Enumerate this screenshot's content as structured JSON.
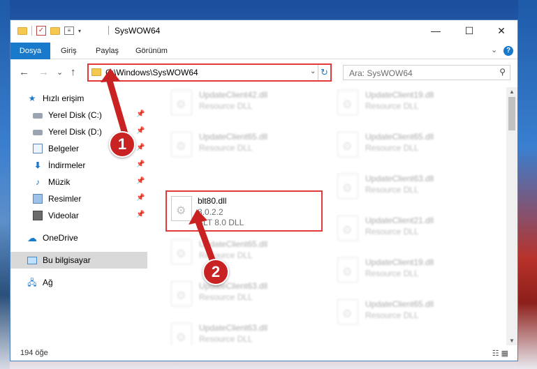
{
  "window": {
    "title": "SysWOW64",
    "controls": {
      "minimize": "—",
      "maximize": "☐",
      "close": "✕"
    }
  },
  "ribbon": {
    "tabs": [
      "Dosya",
      "Giriş",
      "Paylaş",
      "Görünüm"
    ],
    "help": "?"
  },
  "navigation": {
    "back": "←",
    "forward": "→",
    "recent": "⌄",
    "up": "↑",
    "address": "C:\\Windows\\SysWOW64",
    "search_placeholder": "Ara: SysWOW64"
  },
  "sidebar": {
    "items": [
      {
        "label": "Hızlı erişim",
        "icon": "star-icon",
        "pinned": false
      },
      {
        "label": "Yerel Disk (C:)",
        "icon": "disk-icon",
        "pinned": true
      },
      {
        "label": "Yerel Disk (D:)",
        "icon": "disk-icon",
        "pinned": true
      },
      {
        "label": "Belgeler",
        "icon": "document-icon",
        "pinned": true
      },
      {
        "label": "İndirmeler",
        "icon": "download-icon",
        "pinned": true
      },
      {
        "label": "Müzik",
        "icon": "music-icon",
        "pinned": true
      },
      {
        "label": "Resimler",
        "icon": "pictures-icon",
        "pinned": true
      },
      {
        "label": "Videolar",
        "icon": "video-icon",
        "pinned": true
      },
      {
        "label": "OneDrive",
        "icon": "cloud-icon",
        "pinned": false
      },
      {
        "label": "Bu bilgisayar",
        "icon": "computer-icon",
        "pinned": false,
        "selected": true
      },
      {
        "label": "Ağ",
        "icon": "network-icon",
        "pinned": false
      }
    ]
  },
  "files": {
    "highlighted": {
      "name": "blt80.dll",
      "version": "8.0.2.2",
      "description": "BLT 8.0 DLL"
    },
    "left_column": [
      {
        "name": "UpdateClient42.dll",
        "description": "Resource DLL"
      },
      {
        "name": "UpdateClient65.dll",
        "description": "Resource DLL"
      },
      {
        "name": "UpdateClient65.dll",
        "description": "Resource DLL"
      },
      {
        "name": "UpdateClient63.dll",
        "description": "Resource DLL"
      },
      {
        "name": "UpdateClient63.dll",
        "description": "Resource DLL"
      }
    ],
    "right_column": [
      {
        "name": "UpdateClient19.dll",
        "description": "Resource DLL"
      },
      {
        "name": "UpdateClient65.dll",
        "description": "Resource DLL"
      },
      {
        "name": "UpdateClient63.dll",
        "description": "Resource DLL"
      },
      {
        "name": "UpdateClient21.dll",
        "description": "Resource DLL"
      },
      {
        "name": "UpdateClient19.dll",
        "description": "Resource DLL"
      },
      {
        "name": "UpdateClient65.dll",
        "description": "Resource DLL"
      }
    ]
  },
  "status": {
    "item_count": "194 öğe"
  },
  "annotations": {
    "step1": "1",
    "step2": "2",
    "color": "#c82222"
  }
}
